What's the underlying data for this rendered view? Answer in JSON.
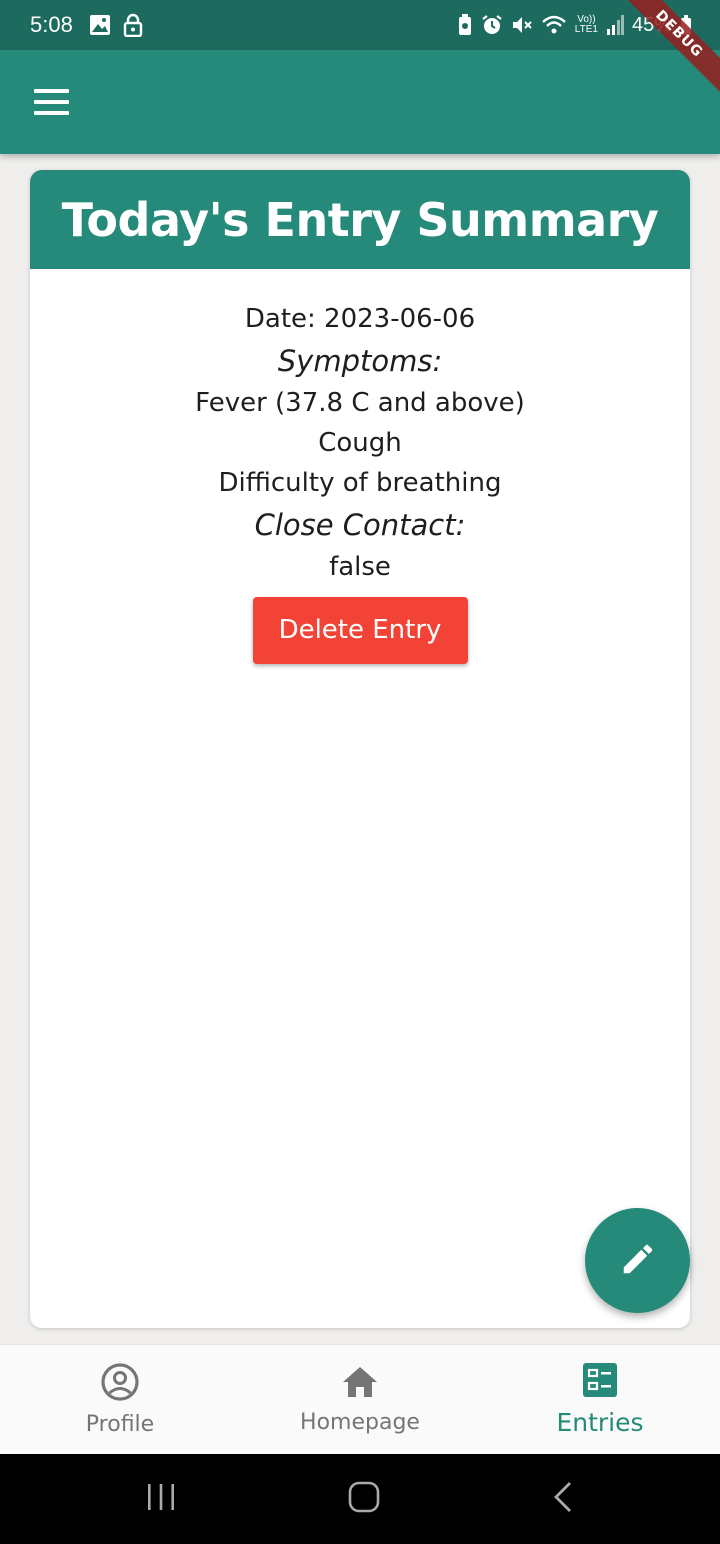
{
  "status_bar": {
    "time": "5:08",
    "battery": "45%",
    "lte_top": "Vo))",
    "lte_bottom": "LTE1",
    "icons": [
      "image-icon",
      "lock-icon",
      "battery-saver-icon",
      "alarm-icon",
      "mute-icon",
      "wifi-icon",
      "signal-icon",
      "battery-icon"
    ]
  },
  "debug_banner": "DEBUG",
  "app_bar": {
    "menu_icon": "menu-icon"
  },
  "entry_card": {
    "title": "Today's Entry Summary",
    "date_line": "Date: 2023-06-06",
    "symptoms_label": "Symptoms:",
    "symptoms": [
      "Fever (37.8 C and above)",
      "Cough",
      "Difficulty of breathing"
    ],
    "close_contact_label": "Close Contact:",
    "close_contact_value": "false",
    "delete_label": "Delete Entry"
  },
  "fab": {
    "icon": "edit-icon"
  },
  "bottom_nav": {
    "items": [
      {
        "label": "Profile",
        "icon": "account-circle-icon",
        "active": false
      },
      {
        "label": "Homepage",
        "icon": "home-icon",
        "active": false
      },
      {
        "label": "Entries",
        "icon": "entries-icon",
        "active": true
      }
    ]
  },
  "colors": {
    "primary": "#258a79",
    "status_bar": "#1c6b5e",
    "delete": "#f34336",
    "background": "#efeeec"
  }
}
